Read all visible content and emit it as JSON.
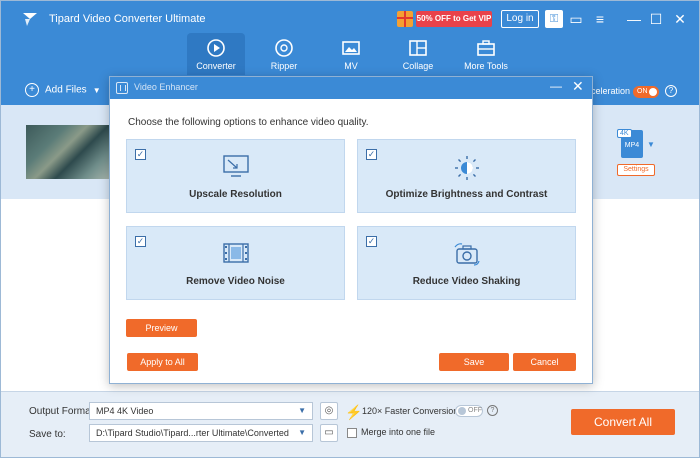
{
  "app": {
    "title": "Tipard Video Converter Ultimate",
    "promo": "50% OFF to Get VIP",
    "login": "Log in",
    "accent": "#3b8ad6",
    "orange": "#f06a2a"
  },
  "nav": {
    "tabs": [
      {
        "label": "Converter",
        "icon": "converter-icon"
      },
      {
        "label": "Ripper",
        "icon": "ripper-icon"
      },
      {
        "label": "MV",
        "icon": "mv-icon"
      },
      {
        "label": "Collage",
        "icon": "collage-icon"
      },
      {
        "label": "More Tools",
        "icon": "toolbox-icon"
      }
    ],
    "active": "Converter"
  },
  "toolbar": {
    "add_files": "Add Files",
    "acceleration": "celeration",
    "accel_toggle": "ON"
  },
  "file": {
    "format_badge_top": "4K",
    "format_badge": "MP4",
    "settings": "Settings"
  },
  "modal": {
    "title": "Video Enhancer",
    "description": "Choose the following options to enhance video quality.",
    "options": [
      {
        "label": "Upscale Resolution",
        "icon": "monitor-upscale-icon",
        "checked": true
      },
      {
        "label": "Optimize Brightness and Contrast",
        "icon": "brightness-icon",
        "checked": true
      },
      {
        "label": "Remove Video Noise",
        "icon": "film-strip-icon",
        "checked": true
      },
      {
        "label": "Reduce Video Shaking",
        "icon": "camera-stabilize-icon",
        "checked": true
      }
    ],
    "preview": "Preview",
    "apply_all": "Apply to All",
    "save": "Save",
    "cancel": "Cancel"
  },
  "bottom": {
    "output_format_label": "Output Format:",
    "output_format_value": "MP4 4K Video",
    "save_to_label": "Save to:",
    "save_to_value": "D:\\Tipard Studio\\Tipard...rter Ultimate\\Converted",
    "faster": "120× Faster Conversion",
    "faster_toggle": "OFF",
    "merge": "Merge into one file",
    "convert_all": "Convert All"
  }
}
